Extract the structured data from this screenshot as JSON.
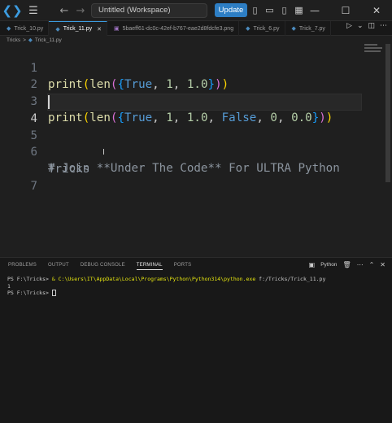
{
  "titlebar": {
    "workspace_title": "Untitled (Workspace)",
    "update_label": "Update",
    "icons": [
      "vscode-logo",
      "menu-icon",
      "arrow-left-icon",
      "arrow-right-icon",
      "layout-icons",
      "minimize-icon",
      "maximize-icon",
      "close-icon"
    ]
  },
  "tabs": [
    {
      "label": "Trick_10.py",
      "active": false
    },
    {
      "label": "Trick_11.py",
      "active": true
    },
    {
      "label": "5baeff61-dc0c-42ef-b767-eae2d8fdcfe3.png",
      "active": false
    },
    {
      "label": "Trick_6.py",
      "active": false
    },
    {
      "label": "Trick_7.py",
      "active": false
    }
  ],
  "breadcrumb": {
    "folder": "Tricks",
    "separator": ">",
    "file": "Trick_11.py"
  },
  "editor": {
    "line_numbers": [
      "1",
      "2",
      "3",
      "4",
      "5",
      "6",
      "",
      "7"
    ],
    "current_line": 4,
    "line1": {
      "fn": "print",
      "fn2": "len",
      "t1": "True",
      "t2": "1",
      "t3": "1.0"
    },
    "line3": {
      "fn": "print",
      "fn2": "len",
      "t1": "True",
      "t2": "1",
      "t3": "1.0",
      "t4": "False",
      "t5": "0",
      "t6": "0.0"
    },
    "line6a": "# Join **Under The Code** For ULTRA Python",
    "line6b": "Tricks"
  },
  "panel": {
    "tabs": [
      "PROBLEMS",
      "OUTPUT",
      "DEBUG CONSOLE",
      "TERMINAL",
      "PORTS"
    ],
    "active_tab": "TERMINAL",
    "terminal_label": "Python",
    "terminal": {
      "prompt1": "PS F:\\Tricks> ",
      "cmd_amp": "& ",
      "cmd_exe": "C:\\Users\\IT\\AppData\\Local\\Programs\\Python\\Python314\\python.exe",
      "cmd_arg": " f:/Tricks/Trick_11.py",
      "output": "1",
      "prompt2": "PS F:\\Tricks> "
    }
  }
}
